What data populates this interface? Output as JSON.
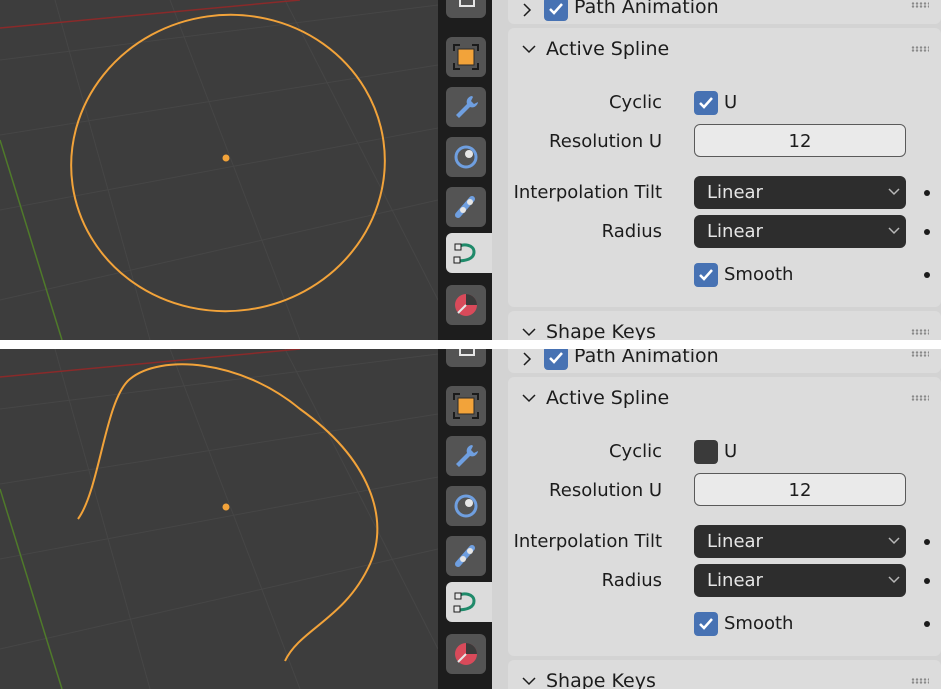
{
  "shots": [
    {
      "panels": {
        "path_animation": {
          "title": "Path Animation",
          "checked": true
        },
        "active_spline": {
          "title": "Active Spline",
          "cyclic": {
            "label": "Cyclic",
            "axis": "U",
            "checked": true
          },
          "resolution_u": {
            "label": "Resolution U",
            "value": "12"
          },
          "interpolation_tilt": {
            "label": "Interpolation Tilt",
            "value": "Linear"
          },
          "radius": {
            "label": "Radius",
            "value": "Linear"
          },
          "smooth": {
            "label": "Smooth",
            "checked": true
          }
        },
        "shape_keys": {
          "title": "Shape Keys"
        }
      }
    },
    {
      "panels": {
        "path_animation": {
          "title": "Path Animation",
          "checked": true
        },
        "active_spline": {
          "title": "Active Spline",
          "cyclic": {
            "label": "Cyclic",
            "axis": "U",
            "checked": false
          },
          "resolution_u": {
            "label": "Resolution U",
            "value": "12"
          },
          "interpolation_tilt": {
            "label": "Interpolation Tilt",
            "value": "Linear"
          },
          "radius": {
            "label": "Radius",
            "value": "Linear"
          },
          "smooth": {
            "label": "Smooth",
            "checked": true
          }
        },
        "shape_keys": {
          "title": "Shape Keys"
        }
      }
    }
  ],
  "tabs": [
    "object-data-tab",
    "object-tab",
    "modifier-tab",
    "physics-tab",
    "constraints-tab",
    "curve-data-tab",
    "material-tab"
  ],
  "colors": {
    "curve": "#f2a33a",
    "viewport_bg": "#3d3d3d",
    "checkbox_on": "#4772b3",
    "active_tab": "#dcdcdc",
    "x_axis": "#8a2a2a",
    "y_axis": "#4f7a2a"
  }
}
